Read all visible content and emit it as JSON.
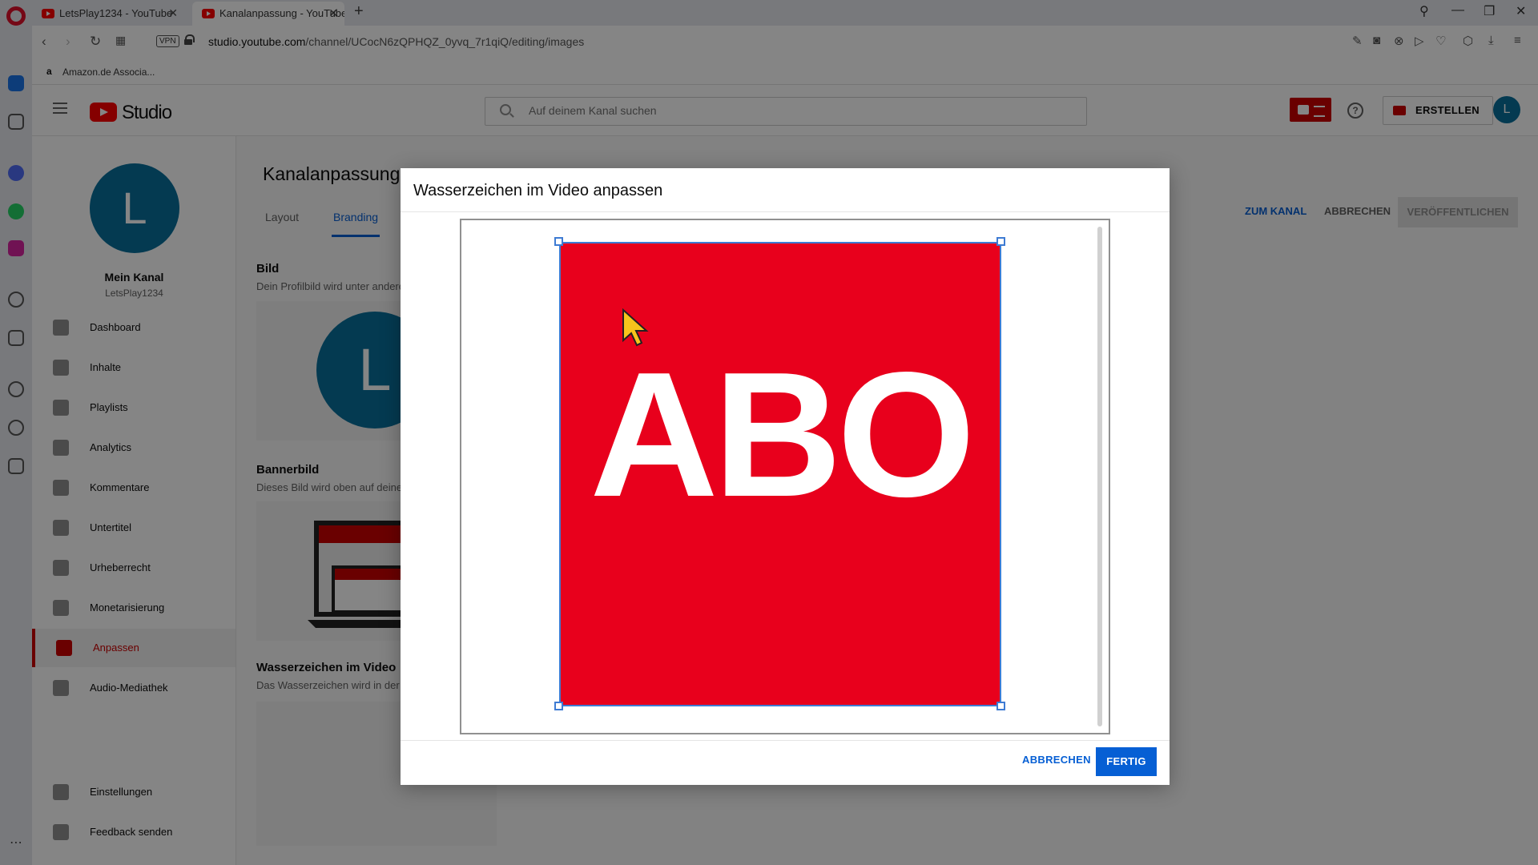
{
  "browser": {
    "tabs": [
      {
        "title": "LetsPlay1234 - YouTube",
        "active": false
      },
      {
        "title": "Kanalanpassung - YouTube",
        "active": true
      }
    ],
    "url_domain": "studio.youtube.com",
    "url_path": "/channel/UCocN6zQPHQZ_0yvq_7r1qiQ/editing/images",
    "vpn_label": "VPN",
    "bookmark": "Amazon.de Associa..."
  },
  "header": {
    "logo_text": "Studio",
    "search_placeholder": "Auf deinem Kanal suchen",
    "create_label": "ERSTELLEN",
    "avatar_letter": "L",
    "help_glyph": "?"
  },
  "sidebar": {
    "avatar_letter": "L",
    "channel_title": "Mein Kanal",
    "channel_handle": "LetsPlay1234",
    "items": [
      {
        "label": "Dashboard",
        "icon": "dashboard-icon"
      },
      {
        "label": "Inhalte",
        "icon": "content-icon"
      },
      {
        "label": "Playlists",
        "icon": "playlists-icon"
      },
      {
        "label": "Analytics",
        "icon": "analytics-icon"
      },
      {
        "label": "Kommentare",
        "icon": "comments-icon"
      },
      {
        "label": "Untertitel",
        "icon": "subtitles-icon"
      },
      {
        "label": "Urheberrecht",
        "icon": "copyright-icon"
      },
      {
        "label": "Monetarisierung",
        "icon": "dollar-icon"
      },
      {
        "label": "Anpassen",
        "icon": "magic-wand-icon",
        "active": true
      },
      {
        "label": "Audio-Mediathek",
        "icon": "audio-library-icon"
      },
      {
        "label": "Einstellungen",
        "icon": "gear-icon"
      },
      {
        "label": "Feedback senden",
        "icon": "feedback-icon"
      }
    ]
  },
  "main": {
    "title": "Kanalanpassung",
    "tabs": [
      {
        "label": "Layout",
        "active": false
      },
      {
        "label": "Branding",
        "active": true
      }
    ],
    "to_channel": "ZUM KANAL",
    "cancel": "ABBRECHEN",
    "publish": "VERÖFFENTLICHEN",
    "sections": {
      "picture": {
        "title": "Bild",
        "desc": "Dein Profilbild wird unter andere"
      },
      "banner": {
        "title": "Bannerbild",
        "desc": "Dieses Bild wird oben auf deine"
      },
      "watermark": {
        "title": "Wasserzeichen im Video",
        "desc": "Das Wasserzeichen wird in der"
      }
    },
    "big_avatar_letter": "L"
  },
  "dialog": {
    "title": "Wasserzeichen im Video anpassen",
    "image_text": "ABO",
    "cancel": "ABBRECHEN",
    "done": "FERTIG"
  },
  "colors": {
    "watermark_red": "#e8001c",
    "accent_blue": "#065fd4",
    "avatar_blue": "#086f9c",
    "crop_handle_blue": "#3e7bd3"
  }
}
